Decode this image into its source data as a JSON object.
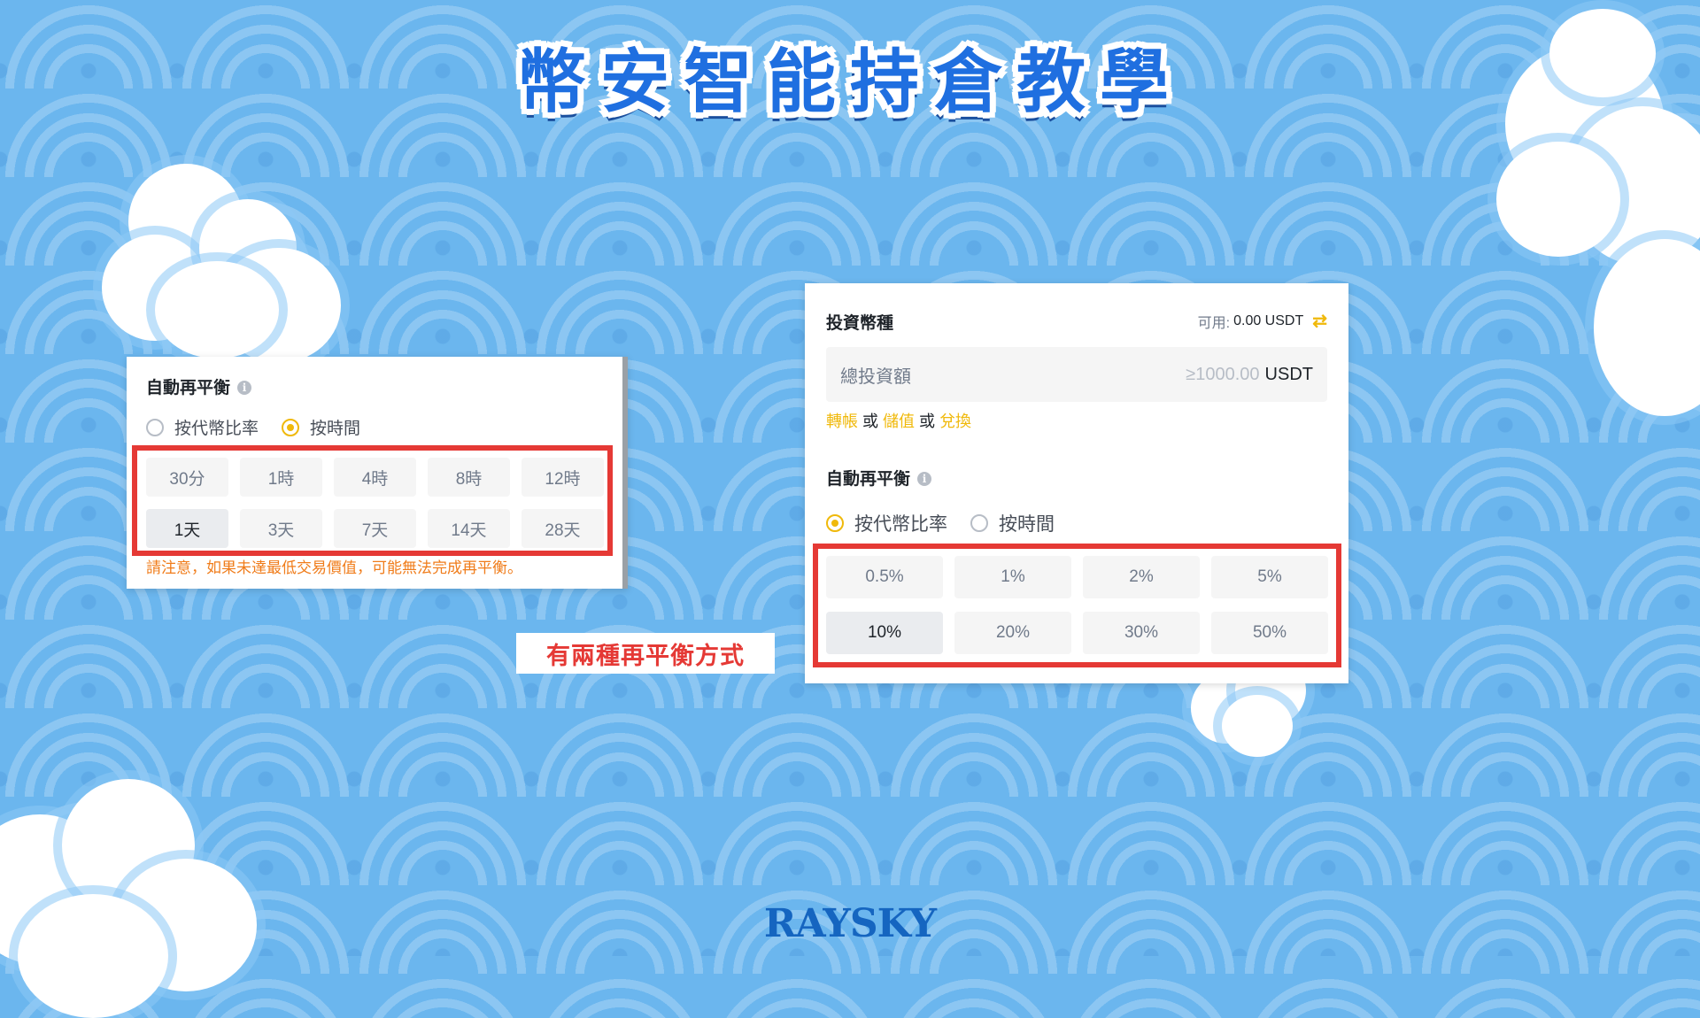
{
  "title": "幣安智能持倉教學",
  "caption": "有兩種再平衡方式",
  "logo": "RAYSKY",
  "left_panel": {
    "section_title": "自動再平衡",
    "radio_options": [
      {
        "label": "按代幣比率",
        "selected": false
      },
      {
        "label": "按時間",
        "selected": true
      }
    ],
    "options": [
      "30分",
      "1時",
      "4時",
      "8時",
      "12時",
      "1天",
      "3天",
      "7天",
      "14天",
      "28天"
    ],
    "selected_option": "1天",
    "warning": "請注意，如果未達最低交易價值，可能無法完成再平衡。"
  },
  "right_panel": {
    "invest_label": "投資幣種",
    "available_label": "可用:",
    "available_value": "0.00 USDT",
    "amount_placeholder": "總投資額",
    "amount_min": "≥1000.00",
    "amount_unit": "USDT",
    "link_transfer": "轉帳",
    "link_or1": "或",
    "link_deposit": "儲值",
    "link_or2": "或",
    "link_convert": "兌換",
    "section_title": "自動再平衡",
    "radio_options": [
      {
        "label": "按代幣比率",
        "selected": true
      },
      {
        "label": "按時間",
        "selected": false
      }
    ],
    "options": [
      "0.5%",
      "1%",
      "2%",
      "5%",
      "10%",
      "20%",
      "30%",
      "50%"
    ],
    "selected_option": "10%"
  },
  "colors": {
    "accent": "#f0b90b",
    "highlight_border": "#e53935",
    "warning": "#f07c1a",
    "background": "#6bb6ee"
  }
}
